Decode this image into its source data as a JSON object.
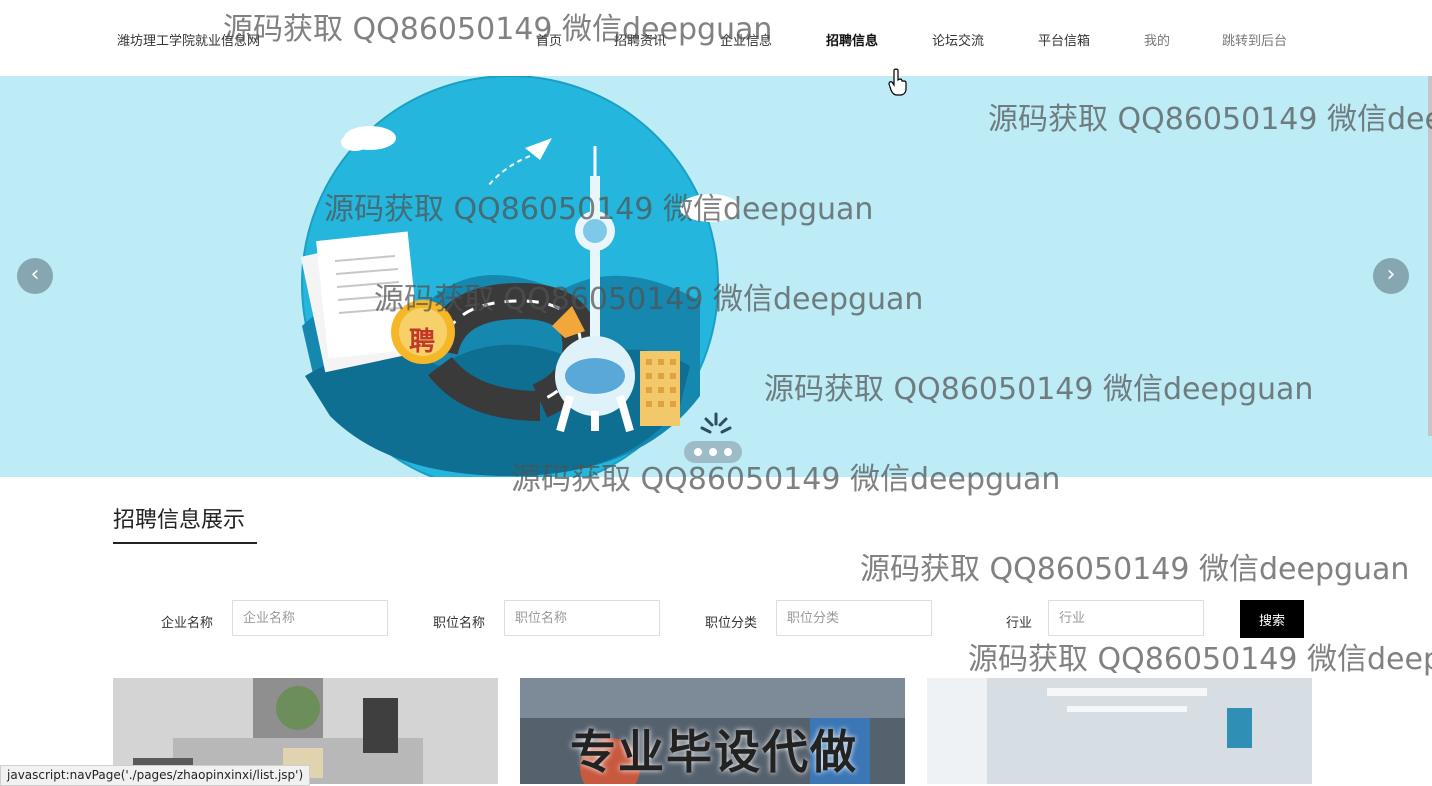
{
  "header": {
    "site_title": "潍坊理工学院就业信息网",
    "nav": [
      {
        "label": "首页"
      },
      {
        "label": "招聘资讯"
      },
      {
        "label": "企业信息"
      },
      {
        "label": "招聘信息"
      },
      {
        "label": "论坛交流"
      },
      {
        "label": "平台信箱"
      },
      {
        "label": "我的"
      },
      {
        "label": "跳转到后台"
      }
    ]
  },
  "banner": {
    "prev_icon": "chevron-left-icon",
    "next_icon": "chevron-right-icon",
    "prev_glyph": "‹",
    "next_glyph": "›",
    "badge_text": "聘"
  },
  "section": {
    "title": "招聘信息展示"
  },
  "search": {
    "fields": [
      {
        "label": "企业名称",
        "placeholder": "企业名称",
        "value": ""
      },
      {
        "label": "职位名称",
        "placeholder": "职位名称",
        "value": ""
      },
      {
        "label": "职位分类",
        "placeholder": "职位分类",
        "value": ""
      },
      {
        "label": "行业",
        "placeholder": "行业",
        "value": ""
      }
    ],
    "button_label": "搜索"
  },
  "cards": [
    {
      "overlay_text": ""
    },
    {
      "overlay_text": "专业毕设代做"
    },
    {
      "overlay_text": ""
    }
  ],
  "watermark_text": "源码获取 QQ86050149 微信deepguan",
  "status_bar": "javascript:navPage('./pages/zhaopinxinxi/list.jsp')",
  "colors": {
    "banner_bg": "#bdecf7",
    "button_bg": "#000000",
    "accent": "#1aa6c9"
  }
}
